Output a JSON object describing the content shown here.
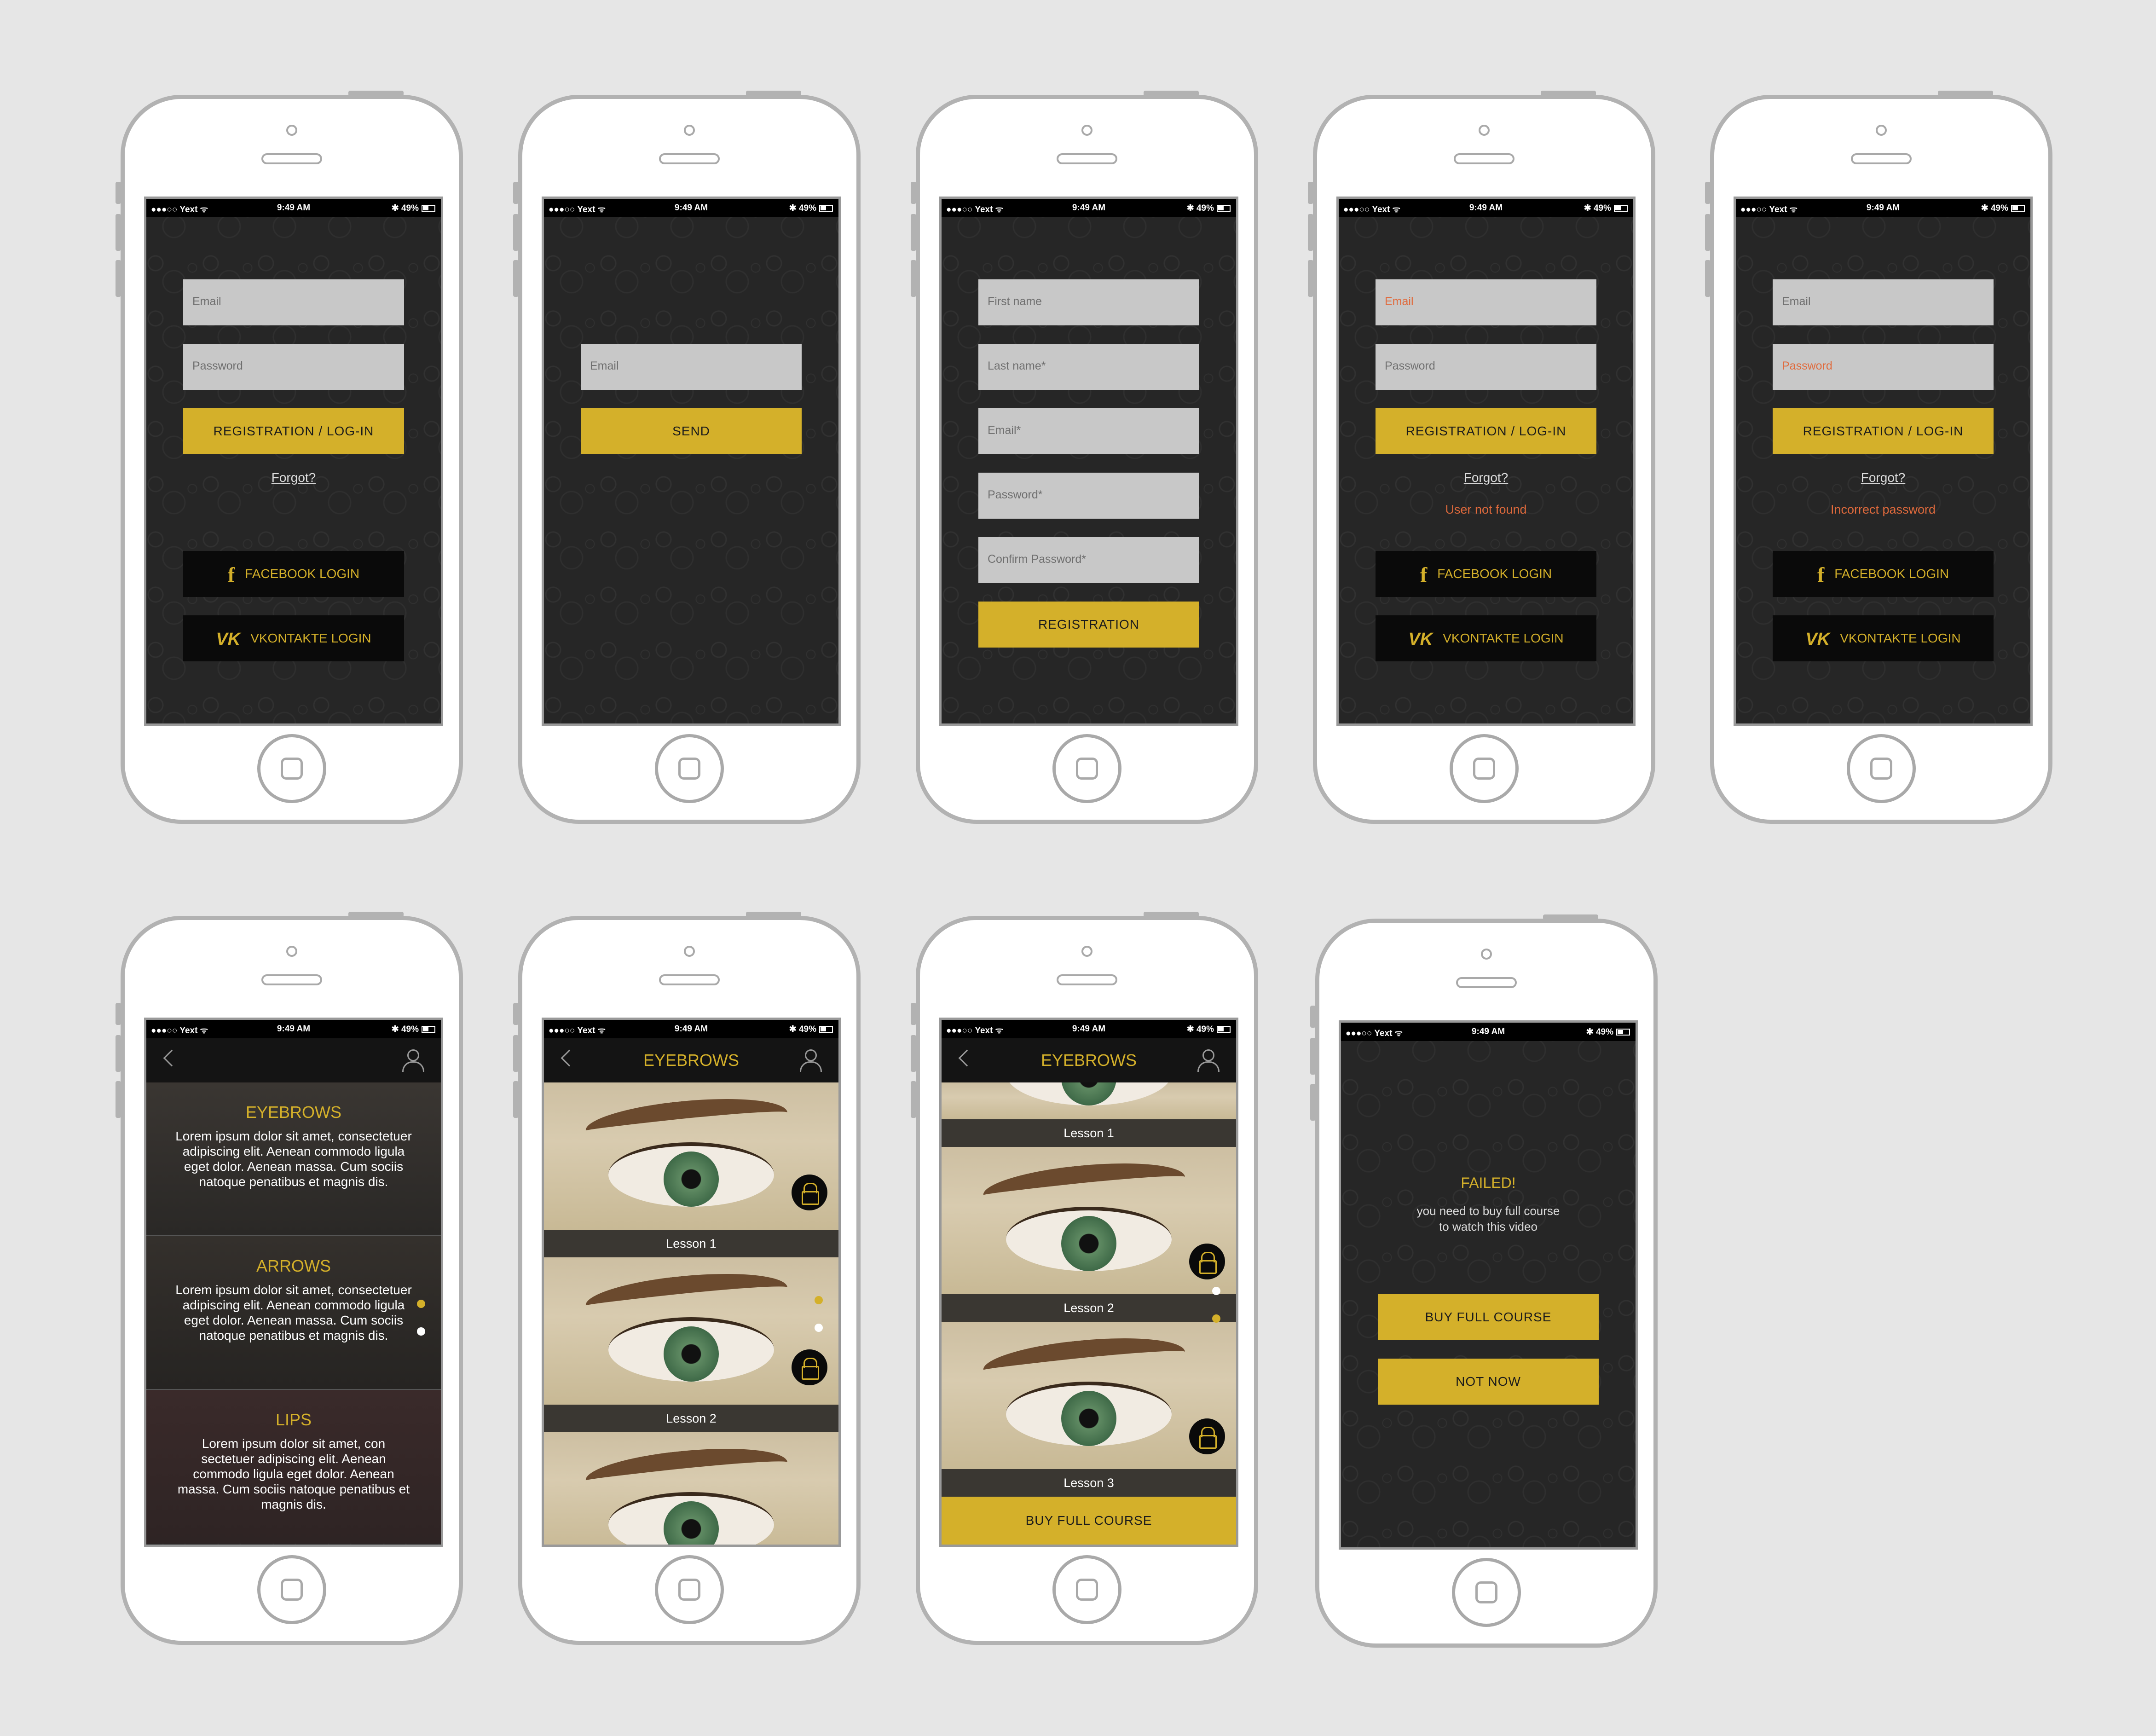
{
  "status_bar": {
    "carrier": "●●●○○ Yext ᯤ",
    "time": "9:49 AM",
    "battery": "✱ 49%"
  },
  "login": {
    "email_placeholder": "Email",
    "password_placeholder": "Password",
    "submit_label": "REGISTRATION / LOG-IN",
    "forgot_label": "Forgot?",
    "facebook_label": "FACEBOOK LOGIN",
    "vk_label": "VKONTAKTE LOGIN",
    "facebook_icon": "f",
    "vk_icon": "VK"
  },
  "forgot": {
    "email_placeholder": "Email",
    "send_label": "SEND"
  },
  "registration": {
    "first_name": "First name",
    "last_name": "Last name*",
    "email": "Email*",
    "password": "Password*",
    "confirm_password": "Confirm Password*",
    "submit_label": "REGISTRATION"
  },
  "errors": {
    "user_not_found": "User not found",
    "incorrect_password": "Incorrect password"
  },
  "categories": {
    "items": [
      {
        "title": "EYEBROWS",
        "text": "Lorem ipsum dolor sit amet, consectetuer adipiscing elit. Aenean commodo ligula eget dolor. Aenean massa. Cum sociis natoque penatibus et magnis dis."
      },
      {
        "title": "ARROWS",
        "text": "Lorem ipsum dolor sit amet, consectetuer adipiscing elit. Aenean commodo ligula eget dolor. Aenean massa. Cum sociis natoque penatibus et magnis dis."
      },
      {
        "title": "LIPS",
        "text": "Lorem ipsum dolor sit amet, con sectetuer adipiscing elit. Aenean commodo ligula eget dolor. Aenean massa. Cum sociis natoque penatibus et magnis dis."
      }
    ]
  },
  "lessons": {
    "title": "EYEBROWS",
    "items": [
      "Lesson 1",
      "Lesson 2",
      "Lesson 3"
    ],
    "buy_label": "BUY FULL COURSE"
  },
  "failed": {
    "title": "FAILED!",
    "line1": "you need to buy full course",
    "line2": "to watch this video",
    "buy_label": "BUY FULL COURSE",
    "not_now_label": "NOT NOW"
  },
  "colors": {
    "accent": "#d4b02a",
    "error": "#e06a3c",
    "field": "#c8c8c8",
    "background": "#e6e6e6"
  }
}
